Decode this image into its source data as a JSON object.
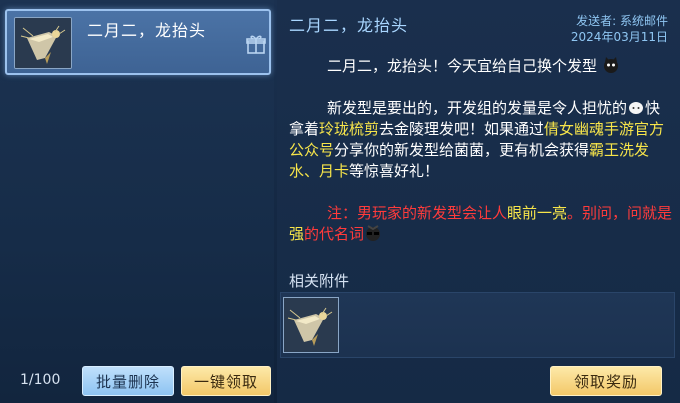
{
  "mail_list": {
    "items": [
      {
        "title": "二月二，龙抬头",
        "thumb_icon": "hair-comb-icon",
        "badge_icon": "gift-icon"
      }
    ],
    "counter": "1/100",
    "batch_delete_label": "批量删除",
    "claim_all_label": "一键领取"
  },
  "detail": {
    "title": "二月二，龙抬头",
    "sender": "发送者: 系统邮件",
    "date": "2024年03月11日",
    "p1": "二月二，龙抬头！今天宜给自己换个发型",
    "p2_a": "新发型是要出的，开发组的发量是令人担忧的",
    "p2_b": "快拿着",
    "p2_item": "玲珑梳剪",
    "p2_c": "去金陵理发吧！如果通过",
    "p2_channel": "倩女幽魂手游官方公众号",
    "p2_d": "分享你的新发型给菌菌，更有机会获得",
    "p2_rewards": "霸王洗发水、月卡",
    "p2_e": "等惊喜好礼！",
    "note_a": "注：男玩家的新发型会让人",
    "note_b": "眼前一亮",
    "note_c": "。别问，问就是",
    "note_d": "强",
    "note_e": "的代名词",
    "attachments_label": "相关附件",
    "attachment_icon": "hair-comb-icon",
    "claim_label": "领取奖励"
  },
  "colors": {
    "highlight_yellow": "#f7e54a",
    "highlight_red": "#ff3b3b",
    "button_gold": "#f3c869",
    "button_blue": "#8ec4f2"
  }
}
